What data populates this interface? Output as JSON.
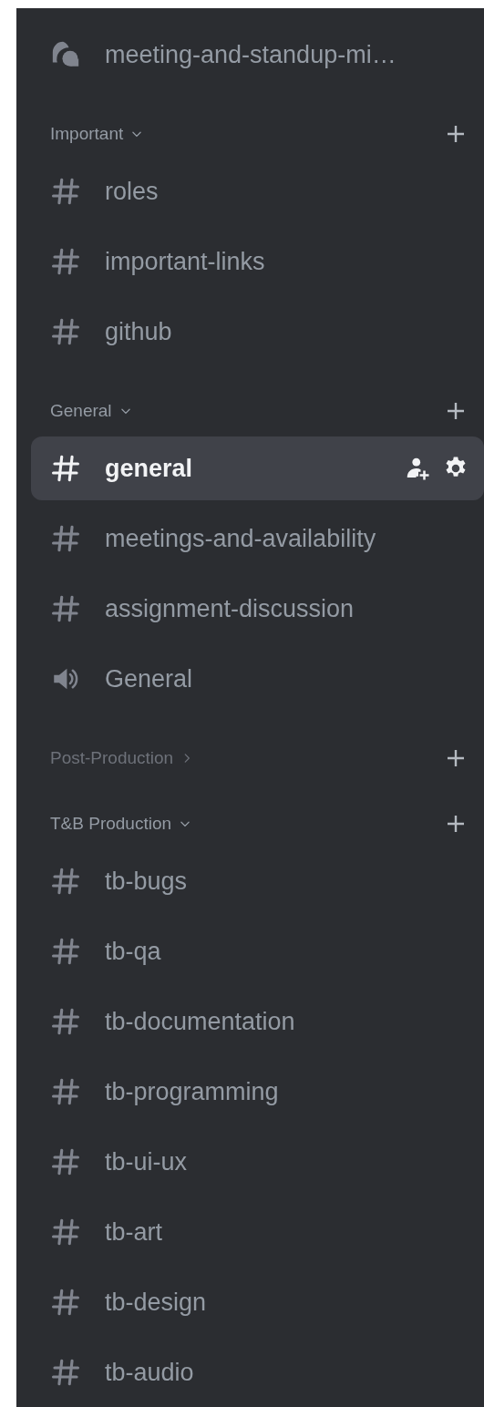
{
  "top_channels": [
    {
      "name": "meeting-and-standup-mi…",
      "kind": "forum",
      "selected": false
    }
  ],
  "categories": [
    {
      "name": "Important",
      "expanded": true,
      "channels": [
        {
          "name": "roles",
          "kind": "text",
          "selected": false
        },
        {
          "name": "important-links",
          "kind": "text",
          "selected": false
        },
        {
          "name": "github",
          "kind": "text",
          "selected": false
        }
      ]
    },
    {
      "name": "General",
      "expanded": true,
      "channels": [
        {
          "name": "general",
          "kind": "text",
          "selected": true
        },
        {
          "name": "meetings-and-availability",
          "kind": "text",
          "selected": false
        },
        {
          "name": "assignment-discussion",
          "kind": "text",
          "selected": false
        },
        {
          "name": "General",
          "kind": "voice",
          "selected": false
        }
      ]
    },
    {
      "name": "Post-Production",
      "expanded": false
    },
    {
      "name": "T&B Production",
      "expanded": true,
      "channels": [
        {
          "name": "tb-bugs",
          "kind": "text",
          "selected": false
        },
        {
          "name": "tb-qa",
          "kind": "text",
          "selected": false
        },
        {
          "name": "tb-documentation",
          "kind": "text",
          "selected": false
        },
        {
          "name": "tb-programming",
          "kind": "text",
          "selected": false
        },
        {
          "name": "tb-ui-ux",
          "kind": "text",
          "selected": false
        },
        {
          "name": "tb-art",
          "kind": "text",
          "selected": false
        },
        {
          "name": "tb-design",
          "kind": "text",
          "selected": false
        },
        {
          "name": "tb-audio",
          "kind": "text",
          "selected": false
        }
      ]
    }
  ]
}
